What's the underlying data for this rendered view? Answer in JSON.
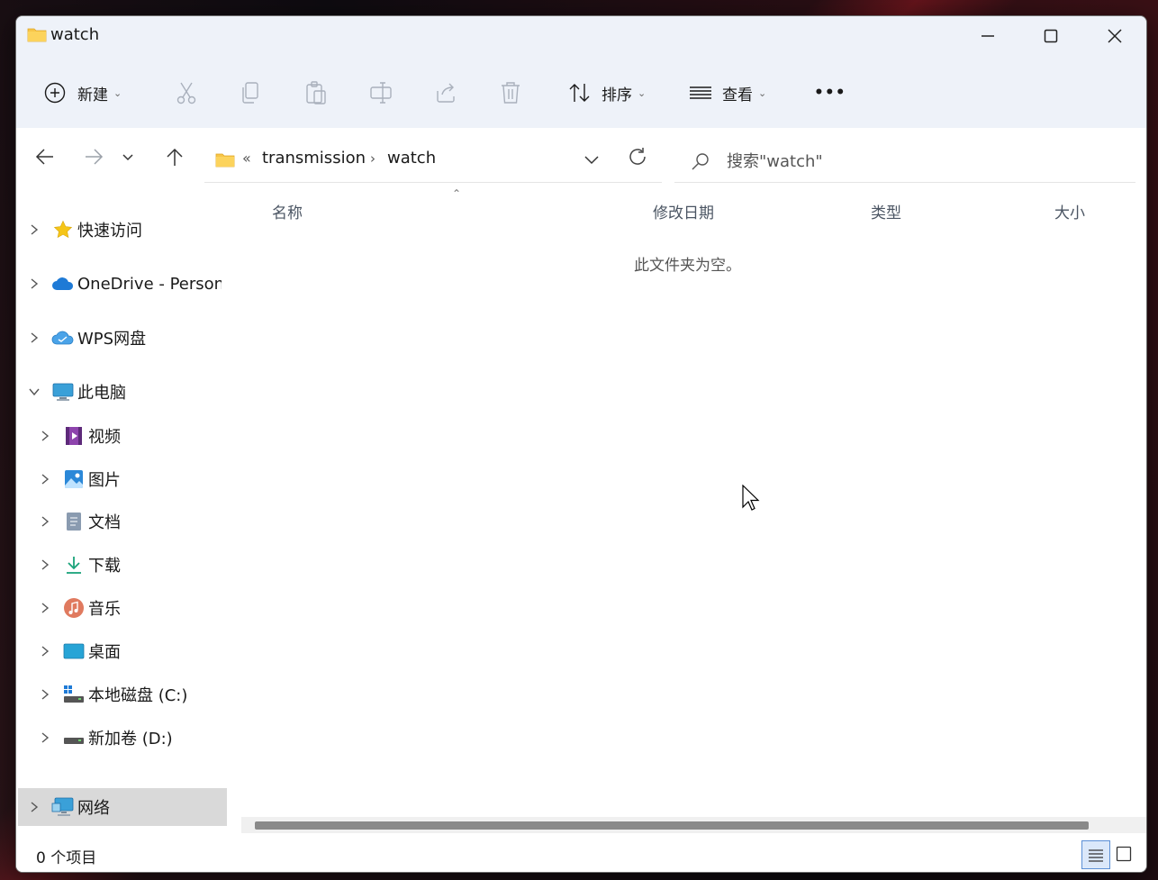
{
  "window": {
    "title": "watch"
  },
  "toolbar": {
    "new_label": "新建",
    "sort_label": "排序",
    "view_label": "查看",
    "more_label": "•••"
  },
  "address": {
    "overflow": "«",
    "crumbs": [
      "transmission",
      "watch"
    ]
  },
  "search": {
    "placeholder": "搜索\"watch\""
  },
  "sidebar": {
    "items": [
      {
        "label": "快速访问",
        "icon": "star-icon"
      },
      {
        "label": "OneDrive - Persona",
        "icon": "onedrive-icon"
      },
      {
        "label": "WPS网盘",
        "icon": "wps-cloud-icon"
      },
      {
        "label": "此电脑",
        "icon": "computer-icon"
      },
      {
        "label": "视频",
        "icon": "video-icon"
      },
      {
        "label": "图片",
        "icon": "picture-icon"
      },
      {
        "label": "文档",
        "icon": "document-icon"
      },
      {
        "label": "下载",
        "icon": "download-icon"
      },
      {
        "label": "音乐",
        "icon": "music-icon"
      },
      {
        "label": "桌面",
        "icon": "desktop-icon"
      },
      {
        "label": "本地磁盘 (C:)",
        "icon": "drive-c-icon"
      },
      {
        "label": "新加卷 (D:)",
        "icon": "drive-d-icon"
      },
      {
        "label": "网络",
        "icon": "network-icon"
      }
    ]
  },
  "columns": {
    "name": "名称",
    "modified": "修改日期",
    "type": "类型",
    "size": "大小"
  },
  "content": {
    "empty_message": "此文件夹为空。"
  },
  "status": {
    "item_count": "0 个项目"
  },
  "colors": {
    "titlebar": "#eef2f9",
    "folder": "#f7c548",
    "selected": "#d9d9d9",
    "accent": "#0067c0"
  }
}
